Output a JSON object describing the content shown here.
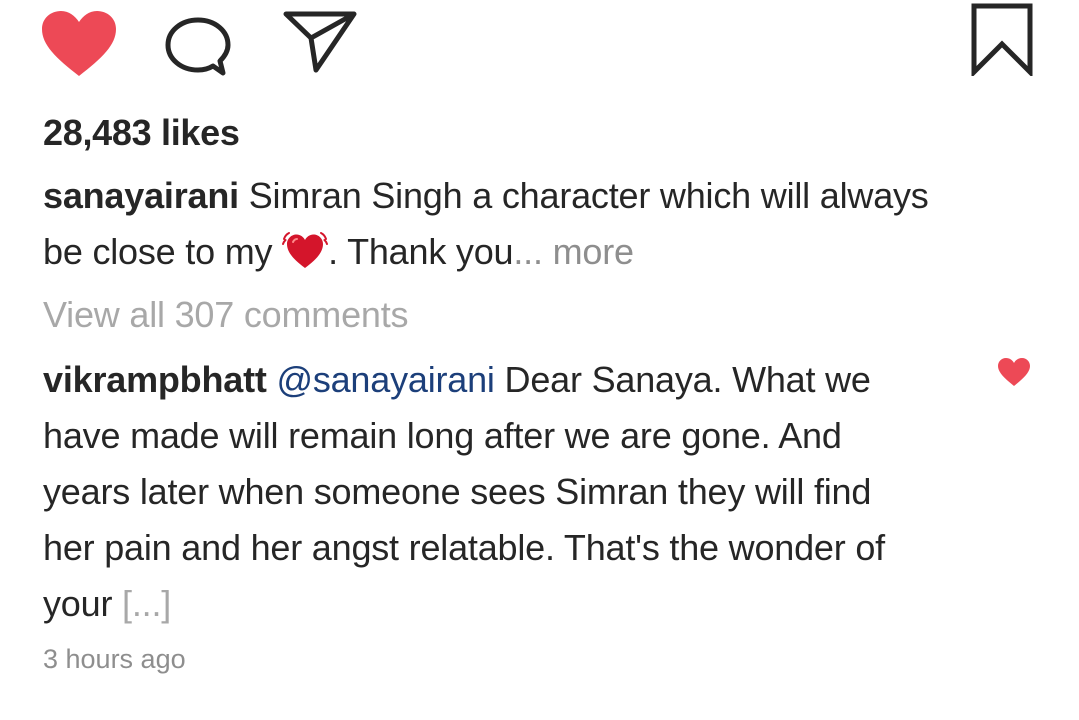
{
  "actions": {
    "like_icon": "heart-filled",
    "comment_icon": "speech-bubble",
    "share_icon": "paper-plane",
    "save_icon": "bookmark",
    "like_color": "#ed4956"
  },
  "post": {
    "likes_text": "28,483 likes",
    "caption": {
      "username": "sanayairani",
      "text_part1": " Simran Singh a character which will always be close to my ",
      "emoji": "beating-heart",
      "text_part2": ". Thank you",
      "ellipsis": "...",
      "more_label": " more"
    },
    "view_all_comments": "View all 307 comments"
  },
  "comment": {
    "username": "vikrampbhatt",
    "mention": "@sanayairani",
    "text": " Dear Sanaya. What we have made will remain long after we are gone. And years later when someone sees Simran they will find her pain and her angst relatable. That's the wonder of your ",
    "truncation": "[...]",
    "liked": true
  },
  "timestamp": "3 hours ago"
}
